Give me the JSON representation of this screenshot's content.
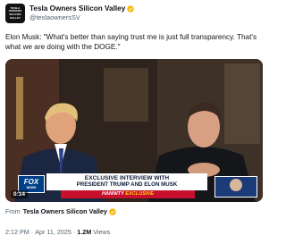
{
  "author": {
    "display_name": "Tesla Owners Silicon Valley",
    "handle": "@teslaownersSV",
    "avatar_lines": [
      "TESLA",
      "OWNERS",
      "SILICON",
      "VALLEY"
    ]
  },
  "tweet": {
    "text": "Elon Musk: \"What's better than saying trust me is just full transparency. That's what we are doing with the DOGE.\""
  },
  "video": {
    "timestamp": "0:14",
    "network_logo": "FOX",
    "network_sub": "NEWS",
    "headline_line1": "EXCLUSIVE INTERVIEW WITH",
    "headline_line2": "PRESIDENT TRUMP AND ELON MUSK",
    "show_name": "HANNITY",
    "show_tag": "EXCLUSIVE"
  },
  "footer": {
    "from_prefix": "From",
    "from_name": "Tesla Owners Silicon Valley",
    "time": "2:12 PM",
    "date": "Apr 11, 2025",
    "separator": "·",
    "views_count": "1.2M",
    "views_label": "Views"
  },
  "colors": {
    "verified": "#f4b400",
    "secondary_text": "#536471",
    "fox_blue": "#003f87",
    "hannity_red": "#c8102e"
  }
}
